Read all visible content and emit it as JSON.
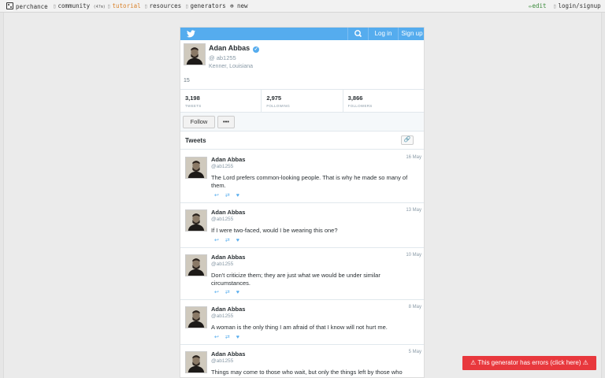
{
  "nav": {
    "perchance": "perchance",
    "community": "community",
    "community_badge": "(47m)",
    "tutorial": "tutorial",
    "resources": "resources",
    "generators": "generators",
    "new": "new",
    "edit": "edit",
    "login": "login/signup"
  },
  "header": {
    "login": "Log in",
    "signup": "Sign up"
  },
  "profile": {
    "name": "Adan Abbas",
    "handle": "ab1255",
    "location": "Kenner, Louisiana",
    "count": "15  ",
    "follow": "Follow",
    "more": "•••"
  },
  "stats": [
    {
      "num": "3,198",
      "label": "Tweets"
    },
    {
      "num": "2,975",
      "label": "Following"
    },
    {
      "num": "3,866",
      "label": "Followers"
    }
  ],
  "tweets_title": "Tweets",
  "tweets": [
    {
      "name": "Adan Abbas",
      "handle": "@ab1255",
      "date": "16 May",
      "text": "The Lord prefers common-looking people. That is why he made so many of them."
    },
    {
      "name": "Adan Abbas",
      "handle": "@ab1255",
      "date": "13 May",
      "text": "If I were two-faced, would I be wearing this one?"
    },
    {
      "name": "Adan Abbas",
      "handle": "@ab1255",
      "date": "10 May",
      "text": "Don't criticize them; they are just what we would be under similar circumstances."
    },
    {
      "name": "Adan Abbas",
      "handle": "@ab1255",
      "date": "8 May",
      "text": "A woman is the only thing I am afraid of that I know will not hurt me."
    },
    {
      "name": "Adan Abbas",
      "handle": "@ab1255",
      "date": "5 May",
      "text": "Things may come to those who wait, but only the things left by those who hustle."
    }
  ],
  "error": "⚠ This generator has errors (click here) ⚠",
  "colors": {
    "twitter_blue": "#55acee",
    "error_red": "#e8383d",
    "tutorial_orange": "#d9822b"
  }
}
